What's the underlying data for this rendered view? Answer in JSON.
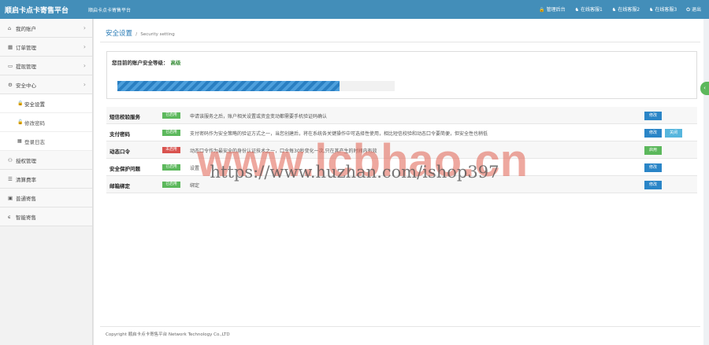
{
  "header": {
    "brand": "顺启卡点卡寄售平台",
    "brand_sub": "顺启卡点卡寄售平台",
    "nav": [
      {
        "icon": "lock-icon",
        "label": "管理后台"
      },
      {
        "icon": "bell-icon",
        "label": "在线客服1"
      },
      {
        "icon": "bell-icon",
        "label": "在线客服2"
      },
      {
        "icon": "bell-icon",
        "label": "在线客服3"
      },
      {
        "icon": "power-icon",
        "label": "退出"
      }
    ]
  },
  "sidebar": {
    "items": [
      {
        "icon": "home-icon",
        "label": "我的账户"
      },
      {
        "icon": "grid-icon",
        "label": "订单管理"
      },
      {
        "icon": "card-icon",
        "label": "提现管理"
      },
      {
        "icon": "gear-icon",
        "label": "安全中心"
      }
    ],
    "sub_items": [
      {
        "icon": "lock-icon",
        "label": "安全设置"
      },
      {
        "icon": "unlock-icon",
        "label": "修改密码"
      },
      {
        "icon": "grid-icon",
        "label": "登录日志"
      }
    ],
    "more_items": [
      {
        "icon": "users-icon",
        "label": "授权管理"
      },
      {
        "icon": "list-icon",
        "label": "清算费率"
      },
      {
        "icon": "dashboard-icon",
        "label": "普通寄售"
      },
      {
        "icon": "e-icon",
        "label": "智能寄售"
      }
    ]
  },
  "breadcrumb": {
    "title": "安全设置",
    "separator": "/",
    "subtitle": "Security setting"
  },
  "security_level": {
    "label": "您目前的账户安全等级：",
    "level": "高级",
    "progress": 0.8
  },
  "settings": [
    {
      "name": "短信校验服务",
      "status": "已启用",
      "status_on": true,
      "desc": "申请该服务之后，账户相关设置或资金变动都需要手机验证码确认",
      "buttons": [
        "修改"
      ]
    },
    {
      "name": "支付密码",
      "status": "已启用",
      "status_on": true,
      "desc": "支付密码作为安全策略的验证方式之一，当您创建后，将在系统各关键操作中可选择性使用，相比短信校验和动态口令要简便，但安全性也稍低",
      "buttons": [
        "修改",
        "关闭"
      ]
    },
    {
      "name": "动态口令",
      "status": "未启用",
      "status_on": false,
      "desc": "动态口令作为最安全的身份认证技术之一，口令每30秒变化一次,只在其产生的时间内有效",
      "buttons": [
        "启用"
      ]
    },
    {
      "name": "安全保护问题",
      "status": "已启用",
      "status_on": true,
      "desc": "设置",
      "buttons": [
        "修改"
      ]
    },
    {
      "name": "邮箱绑定",
      "status": "已启用",
      "status_on": true,
      "desc": "绑定",
      "buttons": [
        "修改"
      ]
    }
  ],
  "footer": "Copyright 顺启卡点卡寄售平台 Network Technology Co.,LTD",
  "watermark": {
    "url": "https://www.huzhan.com/ishop397",
    "big": "www.lcbhao.cn"
  }
}
